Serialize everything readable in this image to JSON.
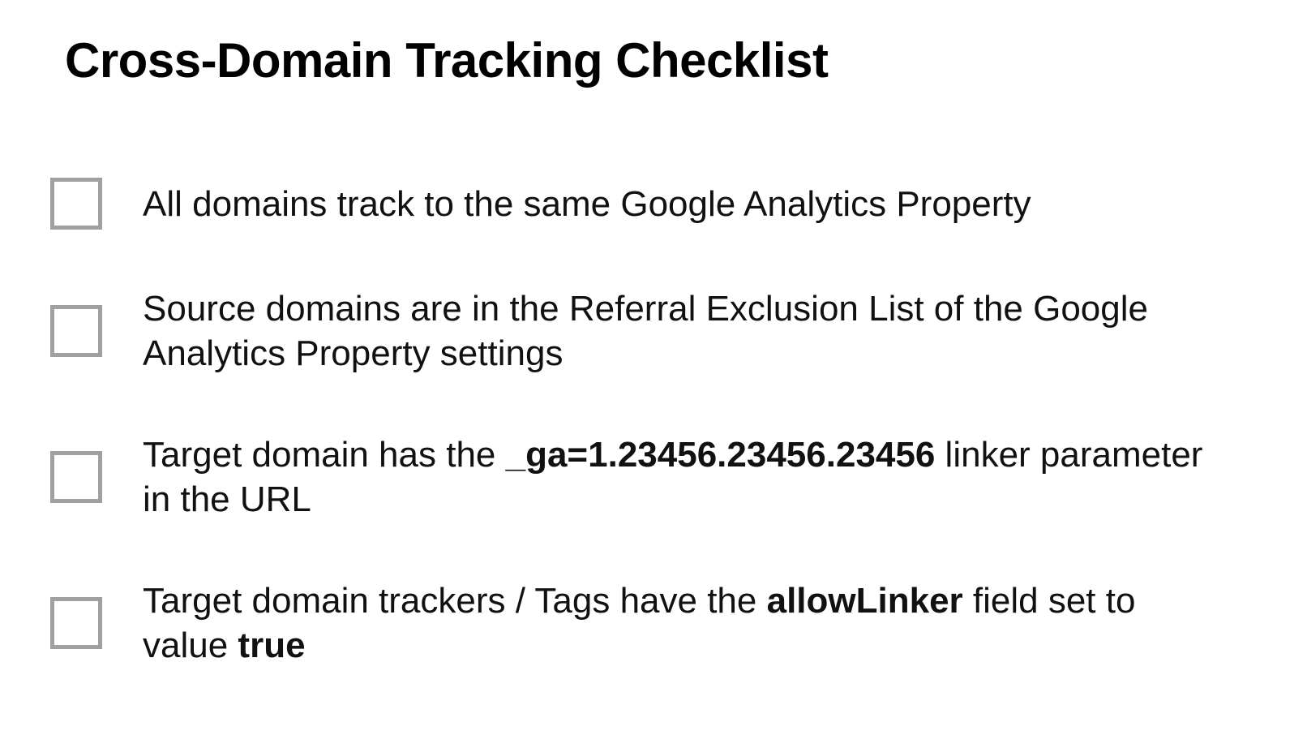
{
  "title": "Cross-Domain Tracking Checklist",
  "items": [
    {
      "text_before": "All domains track to the same Google Analytics Property",
      "bold1": "",
      "mid1": "",
      "bold2": "",
      "text_after": ""
    },
    {
      "text_before": "Source domains are in the Referral Exclusion List of the Google Analytics Property settings",
      "bold1": "",
      "mid1": "",
      "bold2": "",
      "text_after": ""
    },
    {
      "text_before": "Target domain has the ",
      "bold1": "_ga=1.23456.23456.23456",
      "mid1": " linker parameter in the URL",
      "bold2": "",
      "text_after": ""
    },
    {
      "text_before": "Target domain trackers / Tags have the ",
      "bold1": "allowLinker",
      "mid1": " field set to value ",
      "bold2": "true",
      "text_after": ""
    }
  ]
}
